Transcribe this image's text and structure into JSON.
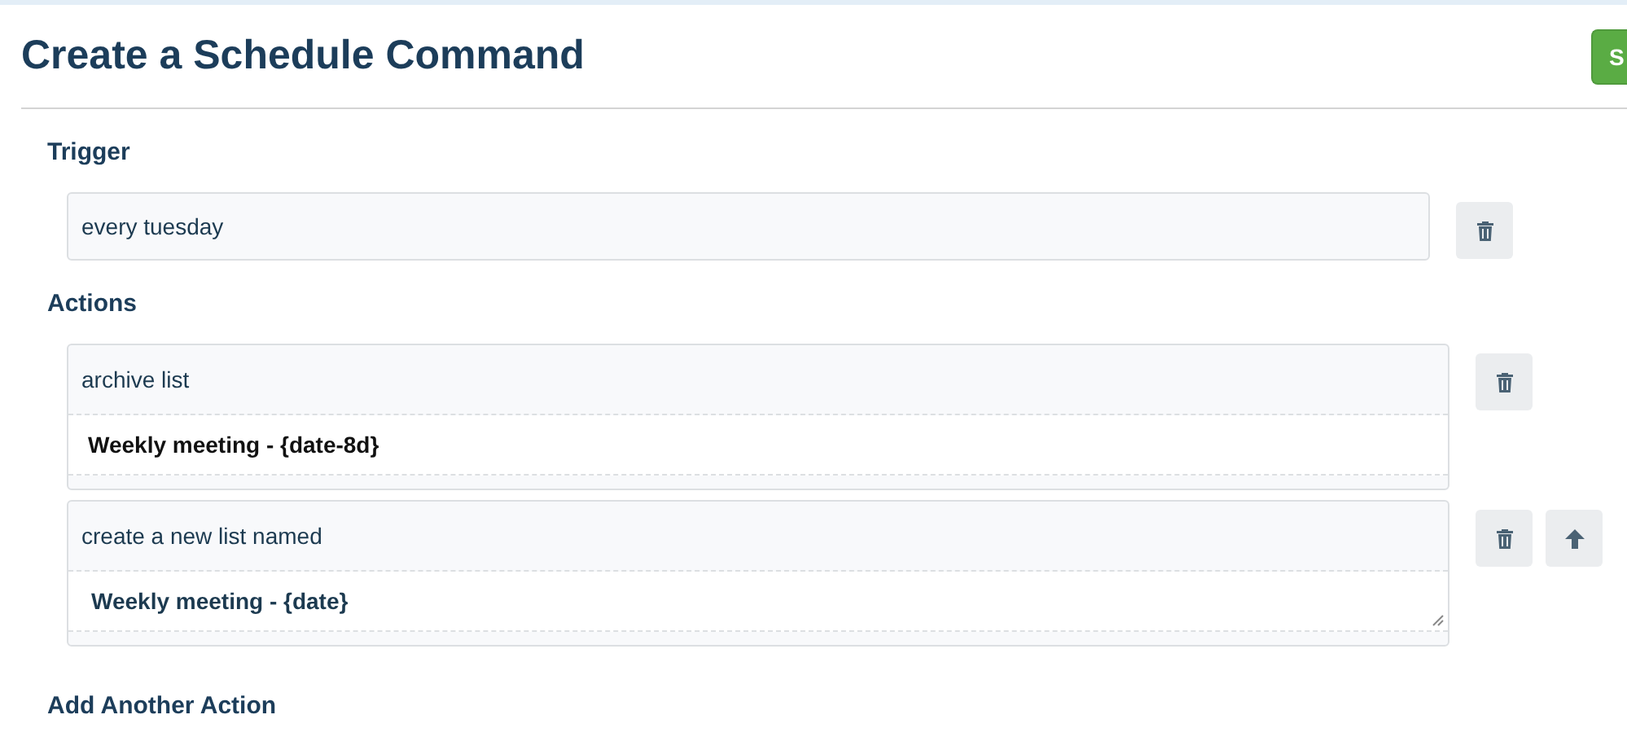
{
  "page": {
    "title": "Create a Schedule Command",
    "save_button": "S"
  },
  "trigger": {
    "heading": "Trigger",
    "value": "every tuesday"
  },
  "actions": {
    "heading": "Actions",
    "items": [
      {
        "command": "archive list",
        "argument": "Weekly meeting - {date-8d}",
        "kind": "text",
        "can_move_up": false
      },
      {
        "command": "create a new list named",
        "argument": "Weekly meeting - {date}",
        "kind": "textarea",
        "can_move_up": true
      }
    ]
  },
  "add_action": {
    "heading": "Add Another Action"
  }
}
